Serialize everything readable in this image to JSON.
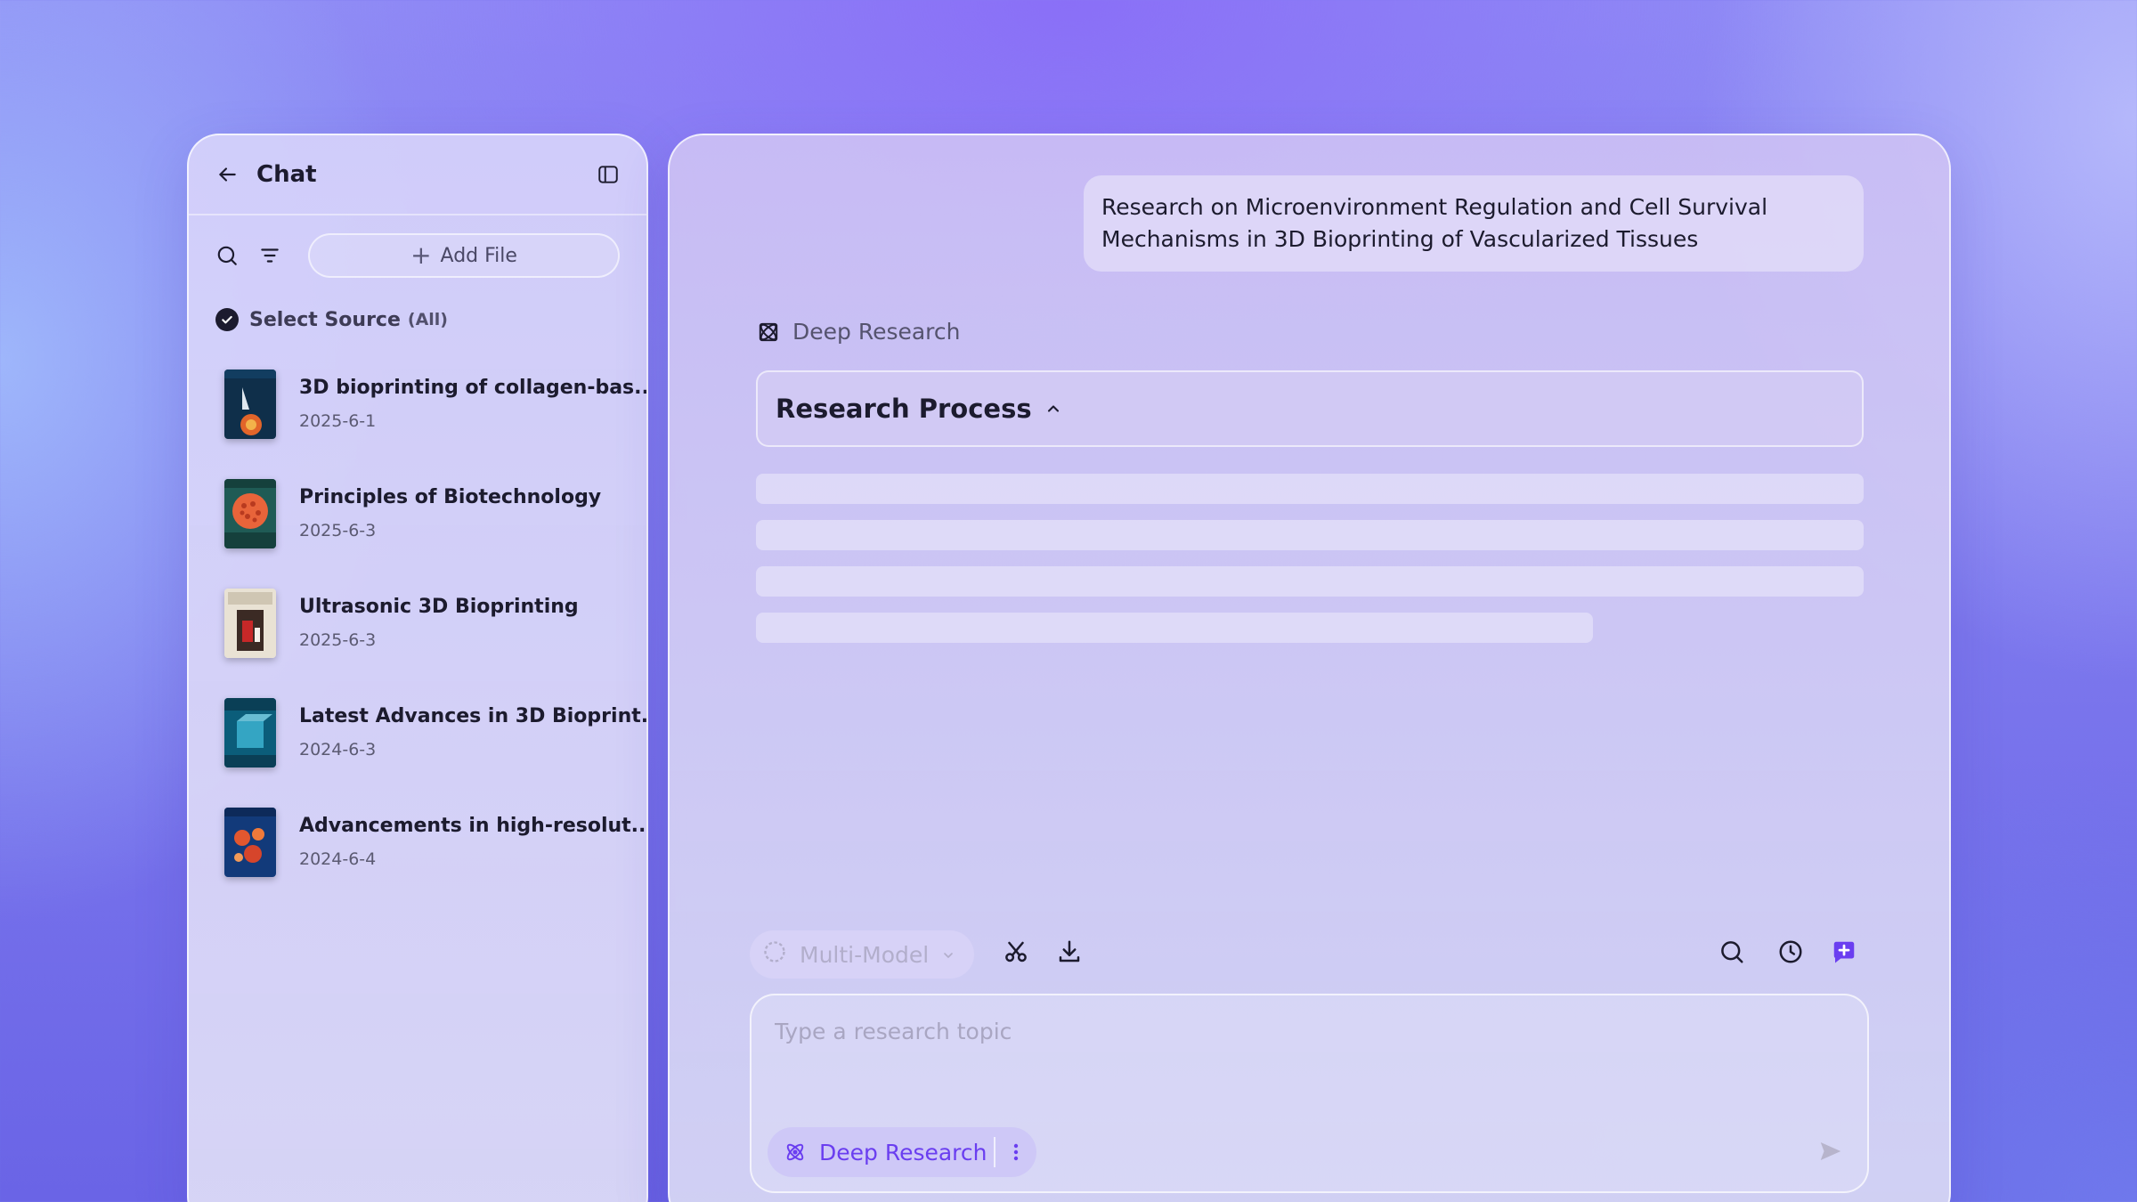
{
  "sidebar": {
    "title": "Chat",
    "add_file_label": "Add File",
    "select_source_label": "Select Source",
    "select_source_filter": "(All)",
    "documents": [
      {
        "title": "3D bioprinting of collagen-bas...",
        "date": "2025-6-1"
      },
      {
        "title": "Principles of Biotechnology",
        "date": "2025-6-3"
      },
      {
        "title": "Ultrasonic 3D Bioprinting",
        "date": "2025-6-3"
      },
      {
        "title": "Latest Advances in 3D Bioprint...",
        "date": "2024-6-3"
      },
      {
        "title": "Advancements in high-resolut...",
        "date": "2024-6-4"
      }
    ],
    "icons": [
      "back-arrow-icon",
      "sidebar-toggle-icon",
      "search-icon",
      "filter-icon",
      "plus-icon",
      "check-circle-icon"
    ]
  },
  "chat": {
    "user_message": "Research on Microenvironment Regulation and Cell Survival Mechanisms in 3D Bioprinting of Vascularized Tissues",
    "mode_label": "Deep Research",
    "process_title": "Research Process",
    "toolbar": {
      "model_label": "Multi-Model",
      "icons": [
        "scissors-icon",
        "download-icon",
        "search-icon",
        "history-icon",
        "new-chat-icon"
      ]
    },
    "input": {
      "placeholder": "Type a research topic",
      "value": "",
      "mode_chip_label": "Deep Research"
    }
  },
  "colors": {
    "accent": "#6a3ef0",
    "text_primary": "#1c1b2e",
    "text_secondary": "#5b5a72"
  }
}
